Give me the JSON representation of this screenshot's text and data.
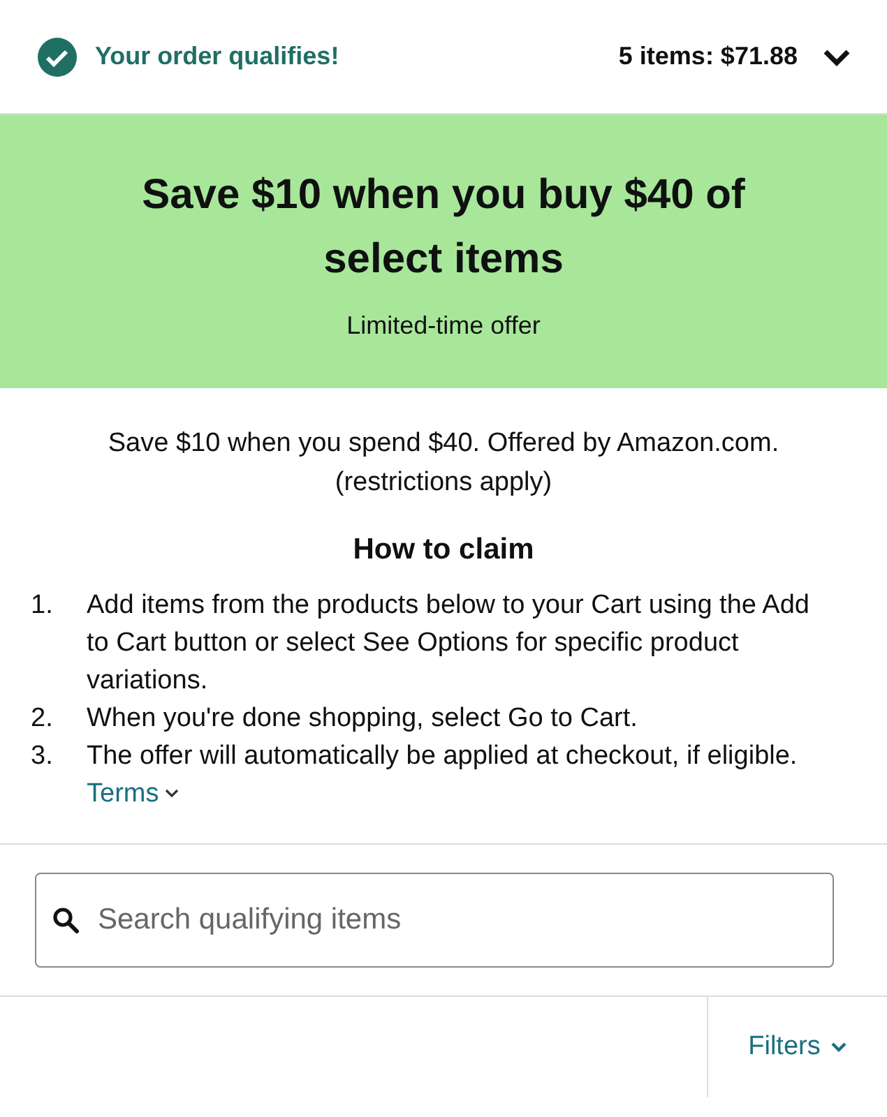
{
  "summary_bar": {
    "status": "Your order qualifies!",
    "total": "5 items: $71.88",
    "expanded": false
  },
  "banner": {
    "title": "Save $10 when you buy $40 of select items",
    "subtitle": "Limited-time offer"
  },
  "description": [
    "Save $10 when you spend $40. Offered by Amazon.com.",
    "(restrictions apply)"
  ],
  "how_to_claim": {
    "heading": "How to claim",
    "steps": [
      {
        "number": "1.",
        "text": "Add items from the products below to your Cart using the Add to Cart button or select See Options for specific product variations."
      },
      {
        "number": "2.",
        "text": "When you're done shopping, select Go to Cart."
      },
      {
        "number": "3.",
        "text": "The offer will automatically be applied at checkout, if eligible.",
        "link": "Terms"
      }
    ]
  },
  "search": {
    "placeholder": "Search qualifying items"
  },
  "filters": {
    "label": "Filters"
  }
}
